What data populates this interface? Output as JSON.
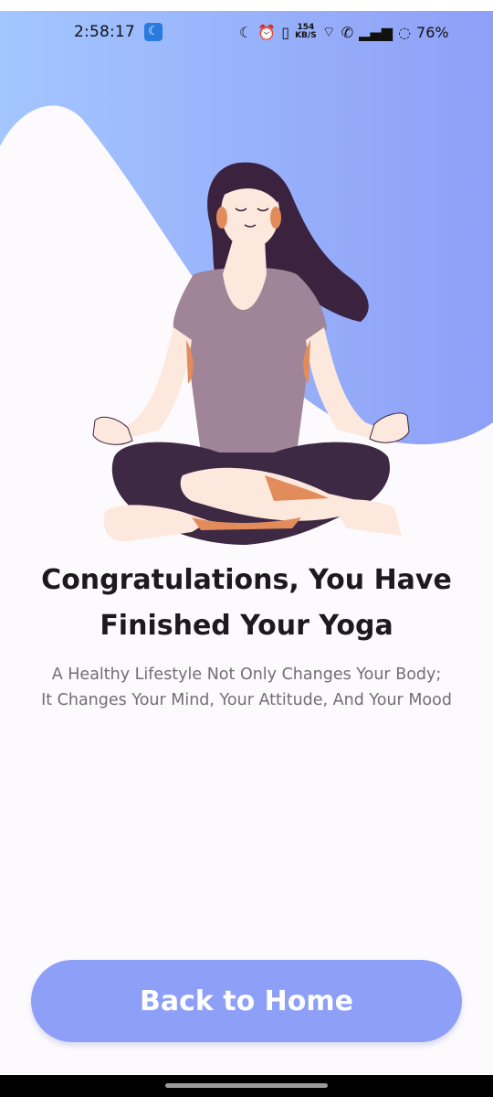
{
  "status_bar": {
    "time": "2:58:17",
    "net_speed_value": "154",
    "net_speed_unit": "KB/S",
    "battery_percent": "76%"
  },
  "colors": {
    "hero_gradient_start": "#a3c6ff",
    "hero_gradient_end": "#8e9ff7",
    "button_bg": "#8e9ff7",
    "hair": "#3b2340",
    "shirt": "#9f8597",
    "pants": "#3d2944",
    "skin": "#fde8dd",
    "accent_skin": "#e38c5b"
  },
  "illustration": {
    "icon": "meditating-woman-illustration"
  },
  "content": {
    "headline_line1": "Congratulations, You Have",
    "headline_line2": "Finished Your Yoga",
    "subtext_line1": "A Healthy Lifestyle Not Only Changes Your Body;",
    "subtext_line2": "It Changes Your Mind, Your Attitude, And Your Mood"
  },
  "actions": {
    "back_home_label": "Back to Home"
  }
}
